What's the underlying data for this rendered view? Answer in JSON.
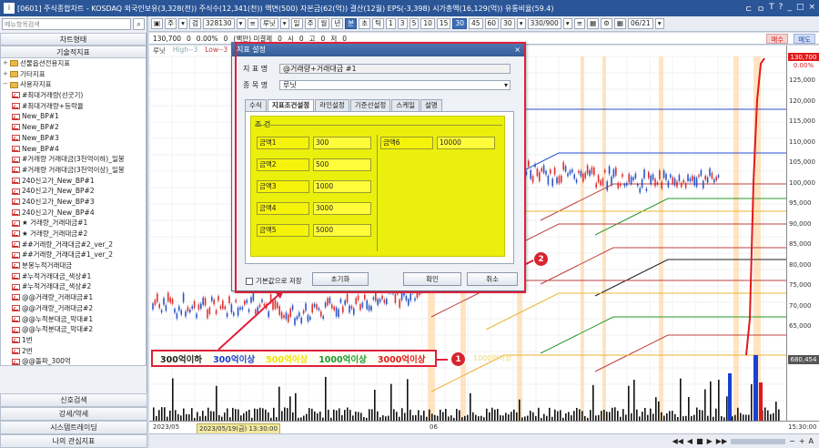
{
  "window": {
    "title": "[0601] 주식종합차트 - KOSDAQ 외국인보유(3,328(천)) 주식수(12,341(천)) 액면(500) 자본금(62(억)) 결산(12월) EPS(-3,398) 시가총액(16,129(억)) 유통비율(59.4)",
    "controls": [
      "ㄷ",
      "ㅁ",
      "T",
      "?",
      "_",
      "□",
      "×"
    ]
  },
  "left": {
    "search_placeholder": "메뉴항목검색",
    "search_icon": "search-icon",
    "top_tabs": [
      "차트형태",
      "기술적지표"
    ],
    "tree": [
      {
        "type": "folder",
        "label": "선물옵션전용지표",
        "expand": "+"
      },
      {
        "type": "folder",
        "label": "기타지표",
        "expand": "+"
      },
      {
        "type": "folder",
        "label": "사용자지표",
        "expand": "−"
      },
      {
        "type": "item",
        "label": "#최대거래량(선굿기)"
      },
      {
        "type": "item",
        "label": "#최대거래량+등락율"
      },
      {
        "type": "item",
        "label": "New_BP#1"
      },
      {
        "type": "item",
        "label": "New_BP#2"
      },
      {
        "type": "item",
        "label": "New_BP#3"
      },
      {
        "type": "item",
        "label": "New_BP#4"
      },
      {
        "type": "item",
        "label": "#거래량 거래대금(3천억이하)_일봉"
      },
      {
        "type": "item",
        "label": "#거래량 거래대금(3천억이상)_일봉"
      },
      {
        "type": "item",
        "label": "240신고가_New_BP#1"
      },
      {
        "type": "item",
        "label": "240신고가_New_BP#2"
      },
      {
        "type": "item",
        "label": "240신고가_New_BP#3"
      },
      {
        "type": "item",
        "label": "240신고가_New_BP#4"
      },
      {
        "type": "item",
        "label": "★ 거래량_거래대금#1"
      },
      {
        "type": "item",
        "label": "★ 거래량_거래대금#2"
      },
      {
        "type": "item",
        "label": "##거래량_거래대금#2_ver_2"
      },
      {
        "type": "item",
        "label": "##거래량_거래대금#1_ver_2"
      },
      {
        "type": "item",
        "label": "분봉누적거래대금"
      },
      {
        "type": "item",
        "label": "#누적거래대금_색상#1"
      },
      {
        "type": "item",
        "label": "#누적거래대금_색상#2"
      },
      {
        "type": "item",
        "label": "@@거래량_거래대금#1"
      },
      {
        "type": "item",
        "label": "@@거래량_거래대금#2"
      },
      {
        "type": "item",
        "label": "@@누적분대금_막대#1"
      },
      {
        "type": "item",
        "label": "@@누적분대금_막대#2"
      },
      {
        "type": "item",
        "label": "1번"
      },
      {
        "type": "item",
        "label": "2번"
      },
      {
        "type": "item",
        "label": "@@돌파_300억"
      },
      {
        "type": "item",
        "label": "@거래량+거래대금 #1"
      },
      {
        "type": "item",
        "label": "@거래량+거래대금 #2"
      }
    ],
    "bottom_tabs": [
      "신호검색",
      "강세/약세",
      "시스템트레이딩",
      "나의 관심지표"
    ]
  },
  "toolbar": {
    "items": [
      "▣",
      "주",
      "▾",
      "검",
      "328130",
      "▾",
      "≡",
      "루닛",
      "▾",
      "일",
      "주",
      "월",
      "년",
      "분",
      "초",
      "틱",
      "1",
      "3",
      "5",
      "10",
      "15",
      "30",
      "45",
      "60",
      "30",
      "▾",
      "330/900",
      "▾",
      "≡",
      "▦",
      "⚙",
      "▦",
      "06/21",
      "▾"
    ],
    "selected": [
      "분",
      "30"
    ],
    "row2": [
      "130,700",
      "0",
      "0.00%",
      "0",
      "(백만) 미결제",
      "0",
      "시",
      "0",
      "고",
      "0",
      "저",
      "0"
    ],
    "buy": "매수",
    "sell": "매도"
  },
  "chart_legend": [
    "루닛",
    "High--3",
    "Low--3",
    "(3.0%)",
    "최저가",
    "하프",
    "최고가",
    "갈",
    "흑",
    "최저가",
    "최고가",
    "#누적봉파 강세패턴",
    "약세패턴"
  ],
  "yaxis": [
    "125,000",
    "120,000",
    "115,000",
    "110,000",
    "105,000",
    "100,000",
    "95,000",
    "90,000",
    "85,000",
    "80,000",
    "75,000",
    "70,000",
    "65,000"
  ],
  "price_tag": {
    "top": "130,700",
    "pct": "0.00%",
    "vol": "680,454"
  },
  "xaxis": {
    "start": "2023/05",
    "cursor": "2023/05/19(금) 13:30:00",
    "mid": "06",
    "time": "15:30:00"
  },
  "level_bar": [
    {
      "text": "300억이하",
      "color": "#222222"
    },
    {
      "text": "300억이상",
      "color": "#1a3fd1"
    },
    {
      "text": "500억이상",
      "color": "#f0e000"
    },
    {
      "text": "1000억이상",
      "color": "#1a9a2a"
    },
    {
      "text": "3000억이상",
      "color": "#e01a1a"
    }
  ],
  "level_bar_ghost": "1000억이상",
  "dialog": {
    "title": "지표 설정",
    "close": "×",
    "name_label": "지 표 명",
    "name_value": "@거래량+거래대금 #1",
    "stock_label": "종 목 명",
    "stock_value": "루닛",
    "tabs": [
      "수식",
      "지표조건설정",
      "라인설정",
      "기준선설정",
      "스케일",
      "설명"
    ],
    "active_tab": "지표조건설정",
    "cond_title": "조 건",
    "conds": [
      {
        "label": "금액1",
        "value": "300"
      },
      {
        "label": "금액2",
        "value": "500"
      },
      {
        "label": "금액3",
        "value": "1000"
      },
      {
        "label": "금액4",
        "value": "3000"
      },
      {
        "label": "금액5",
        "value": "5000"
      },
      {
        "label": "금액6",
        "value": "10000"
      }
    ],
    "default_save": "기본값으로 저장",
    "btn_reset": "초기화",
    "btn_ok": "확인",
    "btn_cancel": "취소"
  },
  "badges": [
    "1",
    "2"
  ]
}
